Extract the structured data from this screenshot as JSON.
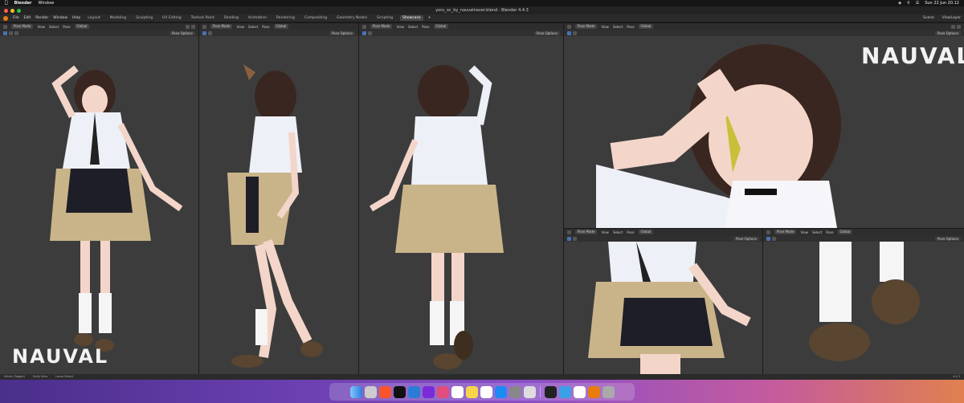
{
  "macos_menubar": {
    "app": "Blender",
    "items": [
      "Window"
    ],
    "clock": "Sun 22 Jun 20.12"
  },
  "window": {
    "title": "yoru_oc_by_nauvalnever.blend - Blender 4.4.3"
  },
  "blender_menu": {
    "items": [
      "File",
      "Edit",
      "Render",
      "Window",
      "Help"
    ],
    "workspaces": [
      "Layout",
      "Modeling",
      "Sculpting",
      "UV Editing",
      "Texture Paint",
      "Shading",
      "Animation",
      "Rendering",
      "Compositing",
      "Geometry Nodes",
      "Scripting",
      "Showcase"
    ],
    "active_workspace": "Showcase",
    "scene_label": "Scene",
    "view_layer_label": "ViewLayer"
  },
  "viewport_header": {
    "mode": "Pose Mode",
    "menus": [
      "View",
      "Select",
      "Pose"
    ],
    "transform": "Global",
    "options": "Pose Options"
  },
  "watermark": "NAUVAL",
  "statusbar": {
    "items": [
      "Select (Toggle)",
      "Dolly View",
      "Lasso Select"
    ],
    "version": "4.4.3"
  },
  "colors": {
    "accent": "#4772b3",
    "blender_orange": "#e87d0d",
    "viewport_bg": "#3c3c3c"
  },
  "dock_icons": [
    "finder-icon",
    "launchpad-icon",
    "brave-icon",
    "capcut-icon",
    "vscode-icon",
    "firefox-icon",
    "arc-icon",
    "photos-icon",
    "notes-icon",
    "calendar-icon",
    "appstore-icon",
    "settings-icon",
    "pages-icon",
    "obs-icon",
    "safari-icon",
    "notion-icon",
    "blender-icon",
    "trash-icon"
  ]
}
